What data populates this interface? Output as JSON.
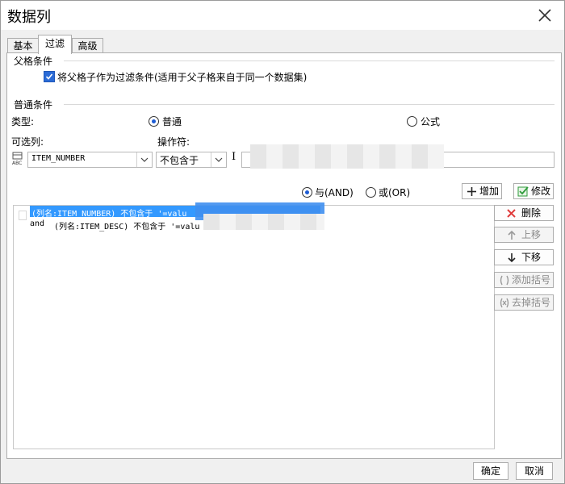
{
  "dialog": {
    "title": "数据列"
  },
  "tabs": [
    {
      "label": "基本"
    },
    {
      "label": "过滤"
    },
    {
      "label": "高级"
    }
  ],
  "parent_group": {
    "label": "父格条件",
    "checkbox_label": "将父格子作为过滤条件(适用于父子格来自于同一个数据集)",
    "checked": true
  },
  "normal_group": {
    "label": "普通条件",
    "type_label": "类型:",
    "type_options": [
      {
        "label": "普通",
        "selected": true
      },
      {
        "label": "公式",
        "selected": false
      }
    ],
    "column_label": "可选列:",
    "column_value": "ITEM_NUMBER",
    "column_icon": "abc-column-icon",
    "operator_label": "操作符:",
    "operator_value": "不包含于",
    "value_text": "I"
  },
  "logic": {
    "and_label": "与(AND)",
    "or_label": "或(OR)",
    "and_selected": true,
    "add_label": "增加",
    "modify_label": "修改"
  },
  "conditions": [
    {
      "prefix": "",
      "text": "(列名:ITEM_NUMBER) 不包含于 '=valu"
    },
    {
      "prefix": "and",
      "text": "(列名:ITEM_DESC) 不包含于 '=valu"
    }
  ],
  "side_buttons": {
    "delete": "删除",
    "up": "上移",
    "down": "下移",
    "add_bracket": "添加括号",
    "remove_bracket": "去掉括号"
  },
  "footer": {
    "ok": "确定",
    "cancel": "取消"
  },
  "colors": {
    "selection": "#3399ff",
    "checkbox": "#2b6bd6",
    "delete_icon": "#e03a3a",
    "modify_icon": "#2e9b3a"
  }
}
